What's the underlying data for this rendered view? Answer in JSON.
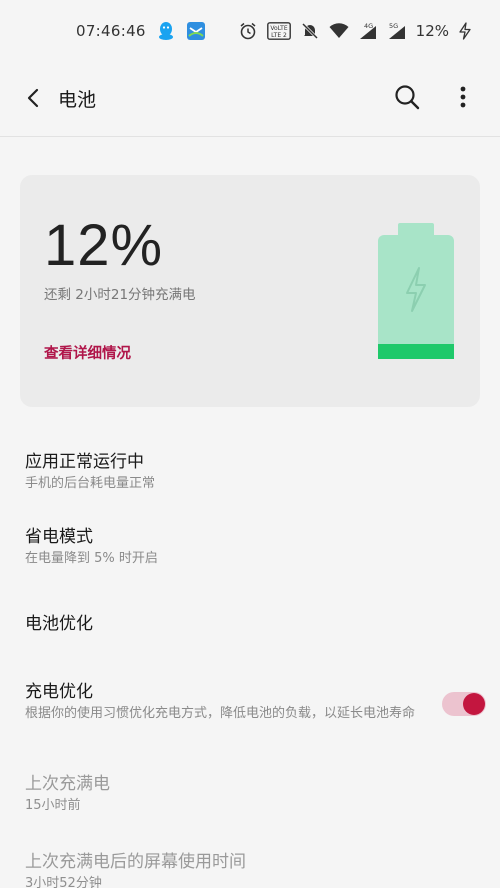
{
  "status_bar": {
    "time": "07:46:46",
    "battery_percent": "12%",
    "volte_label": "VoLTE",
    "signal_4g": "4G",
    "signal_5g": "5G",
    "left_icons": [
      "qq-icon",
      "mail-app-icon"
    ],
    "right_icons": [
      "alarm-icon",
      "volte-icon",
      "mute-icon",
      "wifi-icon",
      "signal-4g-icon",
      "signal-5g-icon",
      "charging-bolt-icon"
    ]
  },
  "header": {
    "title": "电池",
    "back_icon": "chevron-left-icon",
    "search_icon": "search-icon",
    "more_icon": "more-vertical-icon"
  },
  "battery_card": {
    "level": "12%",
    "level_value": 0.12,
    "remaining": "还剩 2小时21分钟充满电",
    "details_link": "查看详细情况",
    "charging": true,
    "colors": {
      "body": "#a8e4c8",
      "fill": "#1ec96a",
      "bolt": "#8ccfb0",
      "link": "#b0164a"
    }
  },
  "settings": {
    "app_status": {
      "title": "应用正常运行中",
      "subtitle": "手机的后台耗电量正常"
    },
    "power_saving": {
      "title": "省电模式",
      "subtitle": "在电量降到 5% 时开启"
    },
    "battery_optimization": {
      "title": "电池优化"
    },
    "charging_optimization": {
      "title": "充电优化",
      "subtitle": "根据你的使用习惯优化充电方式，降低电池的负载，以延长电池寿命",
      "enabled": true,
      "accent": "#c3163f"
    },
    "last_full_charge": {
      "title": "上次充满电",
      "subtitle": "15小时前"
    },
    "screen_time": {
      "title": "上次充满电后的屏幕使用时间",
      "subtitle": "3小时52分钟"
    }
  }
}
